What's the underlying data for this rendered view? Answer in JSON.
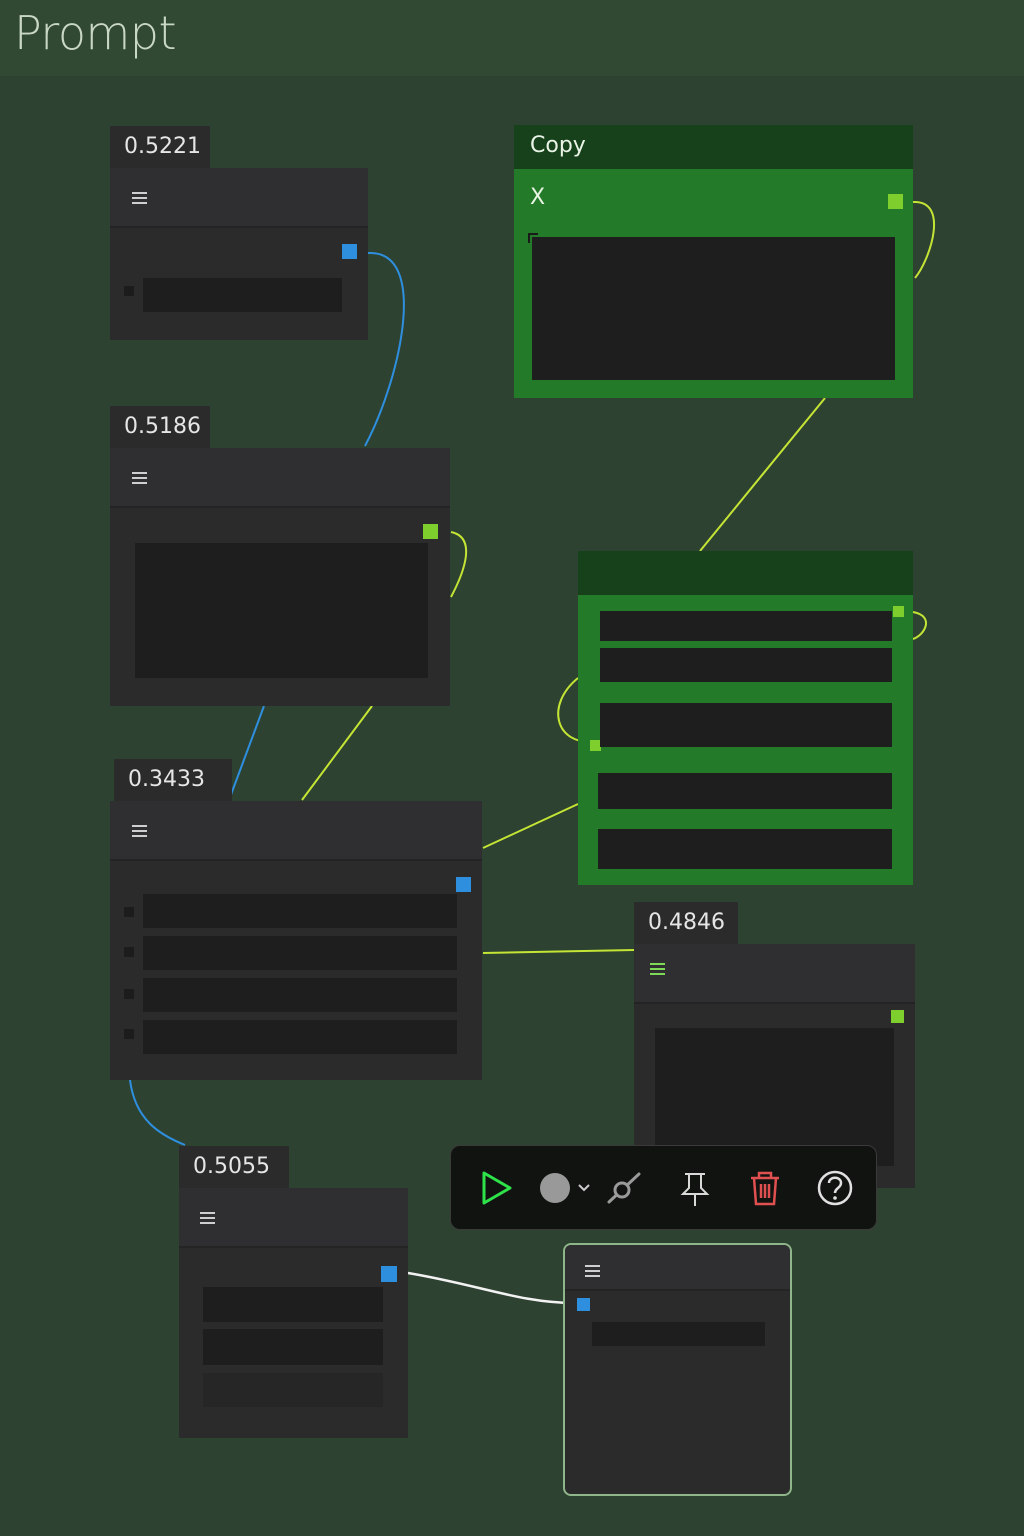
{
  "header": {
    "title": "Prompt"
  },
  "nodes": {
    "n1": {
      "value": "0.5221"
    },
    "n2": {
      "value": "0.5186"
    },
    "n3": {
      "value": "0.3433"
    },
    "n4": {
      "value": "0.4846"
    },
    "n5": {
      "value": "0.5055"
    },
    "copy": {
      "title": "Copy",
      "field_label": "X"
    }
  },
  "toolbar": {
    "icons": [
      "play-icon",
      "color-circle-icon",
      "chevron-down-icon",
      "bypass-icon",
      "pin-icon",
      "trash-icon",
      "help-icon"
    ]
  },
  "colors": {
    "canvas": "#2d4230",
    "node": "#2b2b2b",
    "group_green": "#237a28",
    "wire_blue": "#2f8fdf",
    "wire_yellow": "#c4e535",
    "delete_red": "#e05050"
  }
}
